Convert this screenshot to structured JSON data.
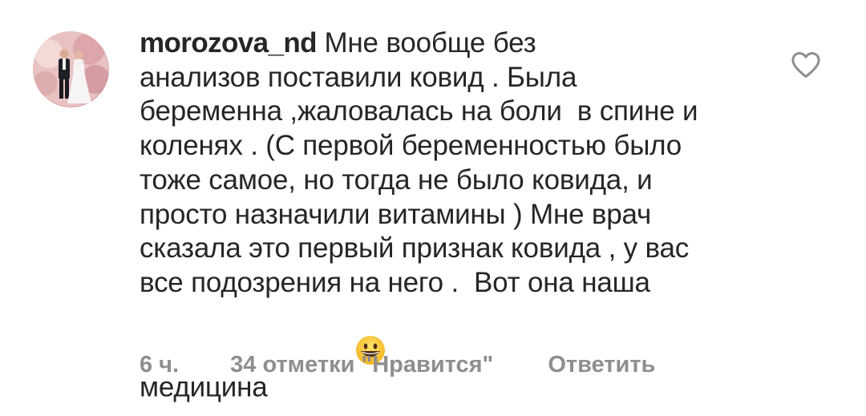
{
  "comment": {
    "username": "morozova_nd",
    "text_lines": [
      "Мне вообще без",
      "анализов поставили ковид . Была",
      "беременна ,жаловалась на боли  в спине и",
      "коленях . (С первой беременностью было",
      "тоже самое, но тогда не было ковида, и",
      "просто назначили витамины ) Мне врач",
      "сказала это первый признак ковида , у вас",
      "все подозрения на него .  Вот она наша",
      "медицина"
    ],
    "emoji": "😀",
    "time": "6 ч.",
    "likes": "34 отметки \"Нравится\"",
    "reply_label": "Ответить",
    "icons": {
      "avatar": "avatar",
      "like": "heart-icon"
    }
  },
  "colors": {
    "text": "#262626",
    "meta": "#8e8e8e",
    "heart_stroke": "#8e8e8e"
  }
}
